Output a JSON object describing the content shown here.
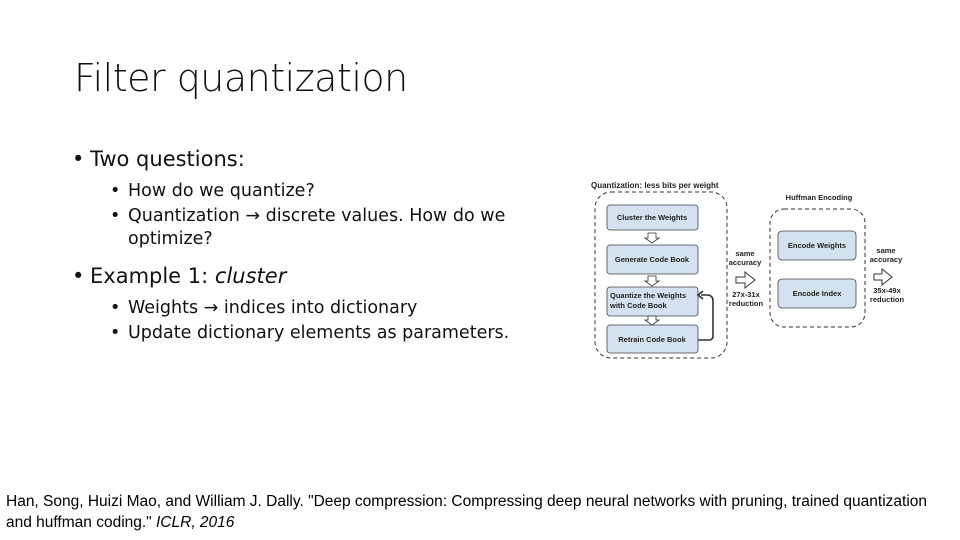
{
  "slide": {
    "title": "Filter quantization",
    "bullets": [
      {
        "text": "Two questions:",
        "sub": [
          "How do we quantize?",
          {
            "before": "Quantization",
            "arrow": "→",
            "after": "discrete values. How do we optimize?"
          }
        ]
      },
      {
        "text_plain": "Example 1: ",
        "text_italic": "cluster",
        "sub": [
          {
            "before": "Weights",
            "arrow": "→",
            "after": "indices into dictionary"
          },
          "Update dictionary elements as parameters."
        ]
      }
    ]
  },
  "diagram": {
    "quantization_title": "Quantization: less bits per weight",
    "quantization_steps": [
      "Cluster the Weights",
      "Generate Code Book",
      "Quantize the Weights",
      "with Code Book",
      "Retrain Code Book"
    ],
    "huffman_title": "Huffman Encoding",
    "huffman_steps": [
      "Encode Weights",
      "Encode Index"
    ],
    "arrow1": {
      "top1": "same",
      "top2": "accuracy",
      "bottom1": "27x-31x",
      "bottom2": "reduction"
    },
    "arrow2": {
      "top1": "same",
      "top2": "accuracy",
      "bottom1": "35x-49x",
      "bottom2": "reduction"
    },
    "colors": {
      "box_fill": "#d3e1f0",
      "box_stroke": "#333333"
    }
  },
  "citation": {
    "text": "Han, Song, Huizi Mao, and William J. Dally. \"Deep compression: Compressing deep neural networks with pruning, trained quantization and huffman coding.\" ",
    "venue": "ICLR, 2016"
  }
}
